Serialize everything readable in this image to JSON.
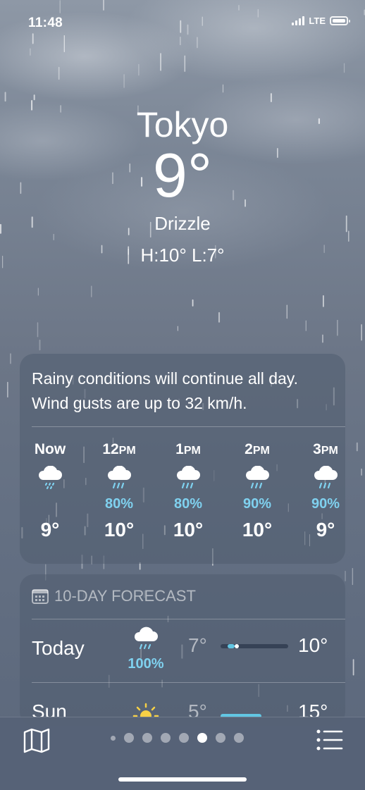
{
  "status": {
    "time": "11:48",
    "network": "LTE"
  },
  "location": {
    "city": "Tokyo",
    "temperature": "9°",
    "condition": "Drizzle",
    "hilo": "H:10°  L:7°"
  },
  "hourly": {
    "summary": "Rainy conditions will continue all day. Wind gusts are up to 32 km/h.",
    "items": [
      {
        "time": "Now",
        "suffix": "",
        "icon": "cloud-drizzle-icon",
        "precip": "",
        "temp": "9°"
      },
      {
        "time": "12",
        "suffix": "PM",
        "icon": "cloud-rain-icon",
        "precip": "80%",
        "temp": "10°"
      },
      {
        "time": "1",
        "suffix": "PM",
        "icon": "cloud-rain-icon",
        "precip": "80%",
        "temp": "10°"
      },
      {
        "time": "2",
        "suffix": "PM",
        "icon": "cloud-rain-icon",
        "precip": "90%",
        "temp": "10°"
      },
      {
        "time": "3",
        "suffix": "PM",
        "icon": "cloud-rain-icon",
        "precip": "90%",
        "temp": "9°"
      }
    ]
  },
  "forecast": {
    "title": "10-DAY FORECAST",
    "icon": "calendar-icon",
    "days": [
      {
        "day": "Today",
        "icon": "cloud-rain-icon",
        "precip": "100%",
        "low": "7°",
        "high": "10°"
      },
      {
        "day": "Sun",
        "icon": "sun-icon",
        "precip": "",
        "low": "5°",
        "high": "15°"
      }
    ]
  },
  "tabbar": {
    "map_icon": "map-icon",
    "list_icon": "list-icon",
    "page_count": 8,
    "active_page": 5
  },
  "colors": {
    "precip": "#7fd1ef",
    "today_bar": "#62c6e3",
    "sun": "#f7d046"
  }
}
